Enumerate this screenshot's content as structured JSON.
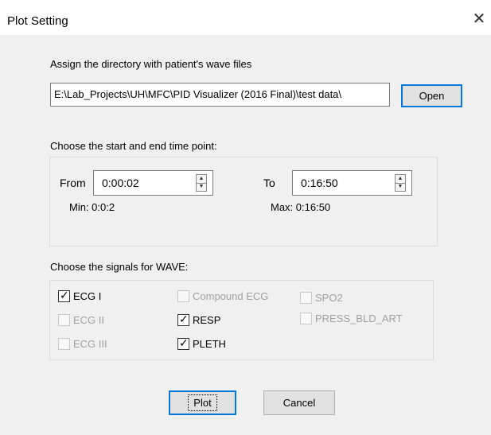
{
  "window": {
    "title": "Plot Setting",
    "close_icon": "close-icon"
  },
  "directory": {
    "label": "Assign the directory with patient's wave files",
    "path": "E:\\Lab_Projects\\UH\\MFC\\PID Visualizer (2016 Final)\\test data\\",
    "open_label": "Open"
  },
  "time": {
    "label": "Choose the start and end time point:",
    "from_label": "From",
    "from_value": "0:00:02",
    "to_label": "To",
    "to_value": "0:16:50",
    "min_text": "Min:  0:0:2",
    "max_text": "Max: 0:16:50"
  },
  "signals": {
    "label": "Choose the signals for WAVE:",
    "items": [
      {
        "label": "ECG I",
        "checked": true,
        "enabled": true
      },
      {
        "label": "ECG II",
        "checked": false,
        "enabled": false
      },
      {
        "label": "ECG III",
        "checked": false,
        "enabled": false
      },
      {
        "label": "Compound ECG",
        "checked": false,
        "enabled": false
      },
      {
        "label": "RESP",
        "checked": true,
        "enabled": true
      },
      {
        "label": "PLETH",
        "checked": true,
        "enabled": true
      },
      {
        "label": "SPO2",
        "checked": false,
        "enabled": false
      },
      {
        "label": "PRESS_BLD_ART",
        "checked": false,
        "enabled": false
      }
    ]
  },
  "buttons": {
    "plot_label": "Plot",
    "cancel_label": "Cancel"
  }
}
